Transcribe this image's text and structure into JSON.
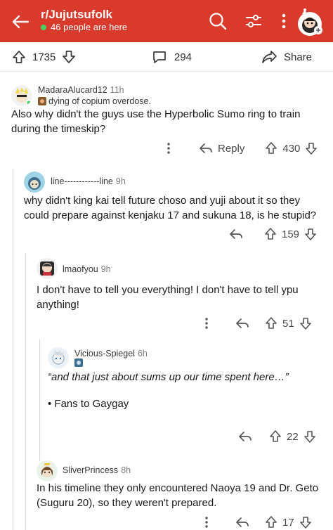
{
  "header": {
    "subreddit": "r/Jujutsufolk",
    "online_text": "46 people are here",
    "brand_color": "#d93a2b",
    "online_color": "#46d160"
  },
  "post_bar": {
    "score": "1735",
    "comments": "294",
    "share_label": "Share"
  },
  "comments": [
    {
      "user": "MadaraAlucard12",
      "age": "11h",
      "flair": "dying of copium overdose.",
      "text": "Also why didn't the guys use the Hyperbolic Sumo ring to train during the timeskip?",
      "reply_label": "Reply",
      "score": "430"
    },
    {
      "user": "line------------line",
      "age": "9h",
      "text": "why didn't king kai tell future choso and yuji about it so they could prepare against kenjaku 17 and sukuna 18, is he stupid?",
      "score": "159"
    },
    {
      "user": "lmaofyou",
      "age": "9h",
      "text": "I don't have to tell you everything! I don't have to tell ypu anything!",
      "score": "51"
    },
    {
      "user": "Vicious-Spiegel",
      "age": "6h",
      "text_line1": "“and that just about sums up our time spent here…”",
      "text_line2": "• Fans to Gaygay",
      "score": "22"
    },
    {
      "user": "SliverPrincess",
      "age": "8h",
      "text": "In his timeline they only encountered Naoya 19 and Dr. Geto (Suguru 20), so they weren't prepared.",
      "score": "17"
    }
  ]
}
